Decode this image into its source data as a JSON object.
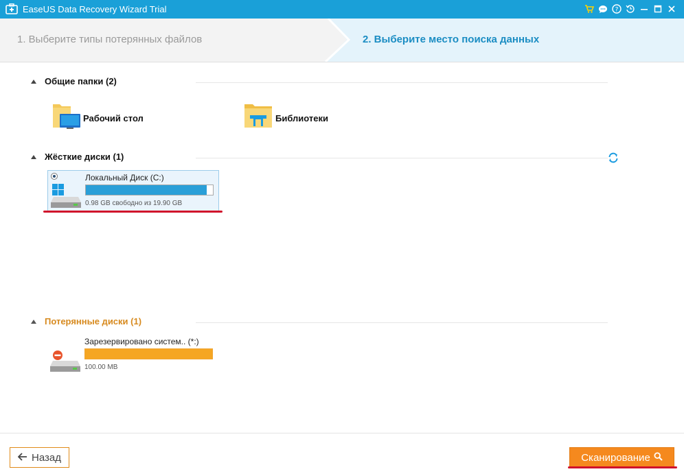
{
  "window": {
    "title": "EaseUS Data Recovery Wizard Trial"
  },
  "steps": {
    "step1_label": "1. Выберите типы потерянных файлов",
    "step2_label": "2. Выберите место поиска данных"
  },
  "common_folders": {
    "header": "Общие папки (2)",
    "items": [
      {
        "label": "Рабочий стол",
        "icon": "desktop-folder-icon"
      },
      {
        "label": "Библиотеки",
        "icon": "libraries-folder-icon"
      }
    ]
  },
  "hard_drives": {
    "header": "Жёсткие диски (1)",
    "drives": [
      {
        "name": "Локальный Диск (C:)",
        "info": "0.98 GB свободно из 19.90 GB",
        "used_fraction": 0.95,
        "bar_color": "#2a9fd8",
        "selected": true
      }
    ]
  },
  "lost_drives": {
    "header": "Потерянные диски (1)",
    "drives": [
      {
        "name": "Зарезервировано систем.. (*:)",
        "info": "100.00 MB",
        "used_fraction": 1.0,
        "bar_color": "#f5a623",
        "selected": false
      }
    ]
  },
  "footer": {
    "back_label": "Назад",
    "scan_label": "Сканирование"
  },
  "colors": {
    "titlebar": "#1aa0d8",
    "accent_orange": "#f5891e",
    "step_active": "#1b8dc3",
    "highlight_red": "#d0112b"
  }
}
